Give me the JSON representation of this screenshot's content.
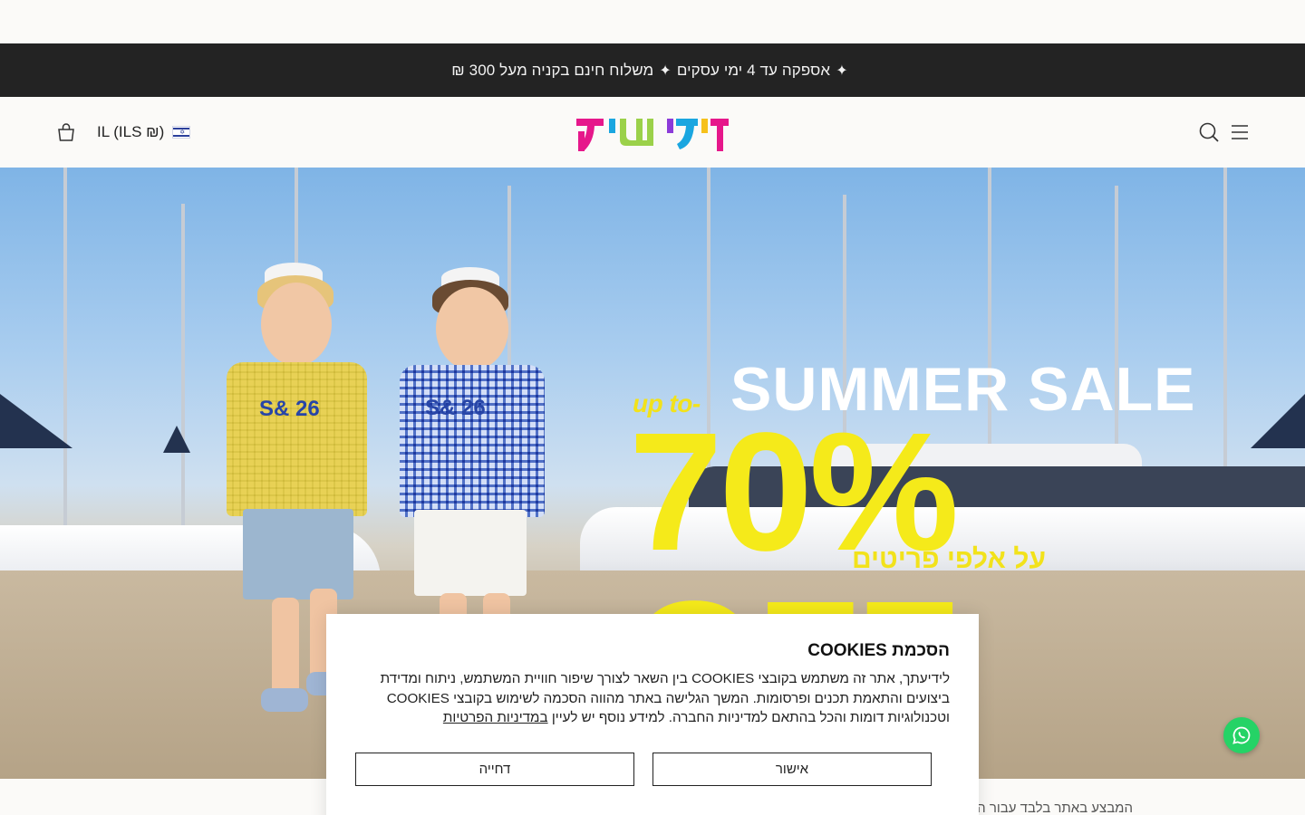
{
  "announcement": {
    "text_a": "אספקה עד 4 ימי עסקים",
    "text_b": "משלוח חינם בקניה מעל 300 ₪",
    "separator": "✦"
  },
  "header": {
    "logo_text": "קידישיק",
    "locale_label": "IL (ILS ₪)",
    "icons": [
      "menu-icon",
      "search-icon",
      "cart-icon",
      "israel-flag-icon"
    ]
  },
  "hero": {
    "promo_small": "up to-",
    "promo_title": "SUMMER SALE",
    "promo_big": "70% OFF",
    "promo_hebrew": "על אלפי פריטים",
    "shirt_print": "S& 26"
  },
  "behind_text": "המבצע באתר בלבד עבור ה...",
  "cookie_banner": {
    "title": "הסכמת COOKIES",
    "body": "לידיעתך, אתר זה משתמש בקובצי COOKIES בין השאר לצורך שיפור חוויית המשתמש, ניתוח ומדידת ביצועים והתאמת תכנים ופרסומות. המשך הגלישה באתר מהווה הסכמה לשימוש בקובצי COOKIES וטכנולוגיות דומות והכל בהתאם למדיניות החברה. למידע נוסף יש לעיין",
    "link_text": "במדיניות הפרטיות",
    "accept_label": "אישור",
    "decline_label": "דחייה"
  },
  "colors": {
    "announcement_bg": "#232323",
    "promo_yellow": "#f5ea1a",
    "whatsapp_green": "#25d366",
    "logo_colors": [
      "#e6178b",
      "#9bd14a",
      "#1aa6e0",
      "#f6c11b",
      "#8c3bd9"
    ]
  }
}
